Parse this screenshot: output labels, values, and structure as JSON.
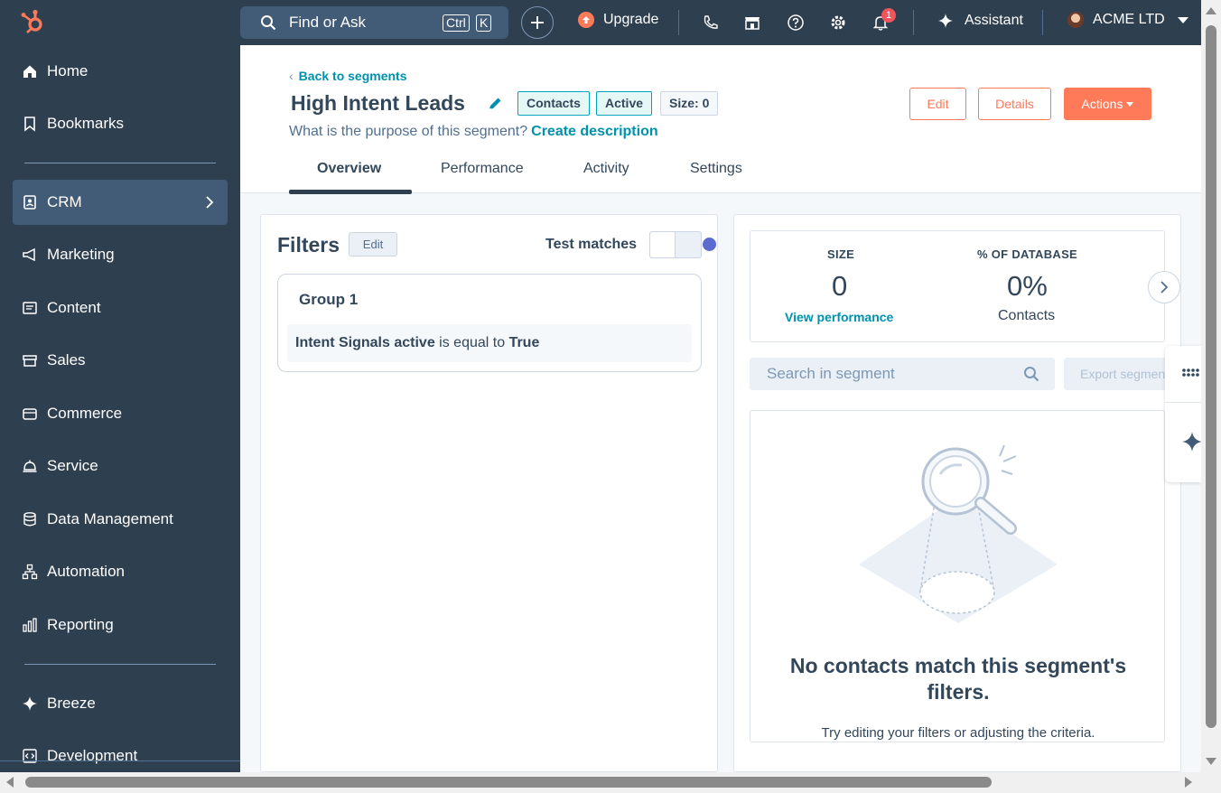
{
  "sidebar": {
    "items": [
      {
        "label": "Home",
        "icon": "home-icon"
      },
      {
        "label": "Bookmarks",
        "icon": "bookmark-icon"
      },
      {
        "label": "CRM",
        "icon": "crm-icon",
        "active": true
      },
      {
        "label": "Marketing",
        "icon": "megaphone-icon"
      },
      {
        "label": "Content",
        "icon": "content-icon"
      },
      {
        "label": "Sales",
        "icon": "sales-icon"
      },
      {
        "label": "Commerce",
        "icon": "commerce-icon"
      },
      {
        "label": "Service",
        "icon": "service-icon"
      },
      {
        "label": "Data Management",
        "icon": "database-icon"
      },
      {
        "label": "Automation",
        "icon": "automation-icon"
      },
      {
        "label": "Reporting",
        "icon": "reporting-icon"
      },
      {
        "label": "Breeze",
        "icon": "sparkle-icon"
      },
      {
        "label": "Development",
        "icon": "code-icon"
      }
    ]
  },
  "topbar": {
    "search_label": "Find or Ask",
    "shortcut_keys": [
      "Ctrl",
      "K"
    ],
    "upgrade_label": "Upgrade",
    "notification_count": "1",
    "assistant_label": "Assistant",
    "account_name": "ACME LTD"
  },
  "header": {
    "back_label": "Back to segments",
    "title": "High Intent Leads",
    "tags": {
      "type": "Contacts",
      "status": "Active",
      "size": "Size: 0"
    },
    "purpose_question": "What is the purpose of this segment?",
    "purpose_link": "Create description",
    "buttons": {
      "edit": "Edit",
      "details": "Details",
      "actions": "Actions"
    },
    "tabs": [
      "Overview",
      "Performance",
      "Activity",
      "Settings"
    ],
    "active_tab": "Overview"
  },
  "filters": {
    "title": "Filters",
    "edit_label": "Edit",
    "test_matches_label": "Test matches",
    "group_title": "Group 1",
    "rule": {
      "property": "Intent Signals active",
      "operator": "is equal to",
      "value": "True"
    }
  },
  "stats": {
    "size_label": "SIZE",
    "size_value": "0",
    "view_performance": "View performance",
    "db_label": "% OF DATABASE",
    "db_value": "0%",
    "db_sub": "Contacts"
  },
  "results": {
    "search_placeholder": "Search in segment",
    "export_label": "Export segment",
    "empty_title": "No contacts match this segment's filters.",
    "empty_sub": "Try editing your filters or adjusting the criteria."
  },
  "colors": {
    "accent": "#ff7a59",
    "link": "#0091ae",
    "nav_bg": "#2e3f50",
    "nav_active": "#425b76"
  }
}
